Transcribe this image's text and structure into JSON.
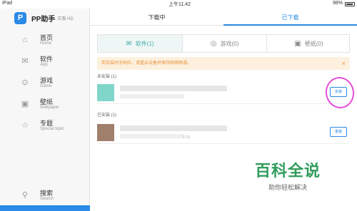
{
  "status_bar": {
    "device": "iPad",
    "time": "上午11:42",
    "battery": "98%"
  },
  "app": {
    "name": "PP助手",
    "edition": "正版 HD",
    "logo_letter": "P"
  },
  "sidebar": {
    "items": [
      {
        "label": "首页",
        "sub": "Home",
        "icon": "home-icon"
      },
      {
        "label": "软件",
        "sub": "App",
        "icon": "app-icon"
      },
      {
        "label": "游戏",
        "sub": "Game",
        "icon": "game-icon"
      },
      {
        "label": "壁纸",
        "sub": "Wallpaper",
        "icon": "wallpaper-icon"
      },
      {
        "label": "专题",
        "sub": "Special topic",
        "icon": "star-icon"
      }
    ],
    "search": {
      "label": "搜索",
      "sub": "Search"
    }
  },
  "segment": {
    "left": "下载中",
    "right": "已下载",
    "active": "right"
  },
  "tabs": [
    {
      "label": "软件(1)",
      "icon": "mail-icon",
      "active": true
    },
    {
      "label": "游戏(0)",
      "icon": "gamepad-icon",
      "active": false
    },
    {
      "label": "壁纸(0)",
      "icon": "image-icon",
      "active": false
    }
  ],
  "notice": {
    "text": "若安装时无响应，请重启设备并保持网络畅通。",
    "close": "×"
  },
  "sections": {
    "not_installed": {
      "title": "未安装 (1)",
      "button": "安装"
    },
    "installed": {
      "title": "已安装 (1)",
      "button": "重装",
      "meta": "2-15"
    }
  },
  "watermark": {
    "title": "百科全说",
    "subtitle": "助你轻松解决"
  },
  "colors": {
    "accent": "#2a8ae8",
    "notice_bg": "#fdf0de",
    "notice_text": "#e8963c",
    "highlight": "#e64fd8",
    "watermark": "#2f9c5c"
  }
}
